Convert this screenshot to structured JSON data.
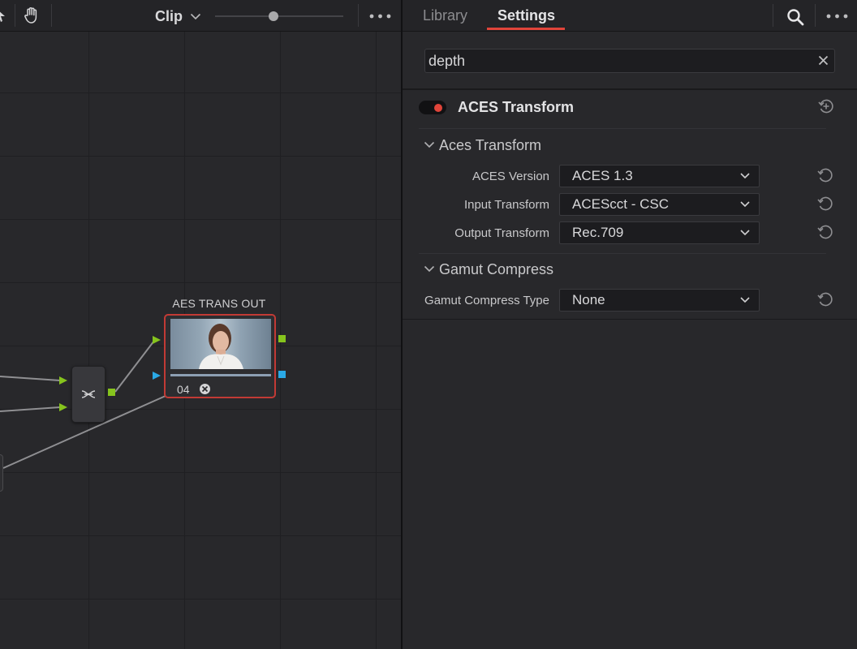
{
  "toolbar": {
    "mode_label": "Clip",
    "zoom_level": 0.45
  },
  "nodes": {
    "output_node": {
      "title": "AES TRANS OUT",
      "number": "04"
    }
  },
  "tabs": {
    "library": "Library",
    "settings": "Settings"
  },
  "search": {
    "value": "depth"
  },
  "effect": {
    "name": "ACES Transform",
    "enabled": true,
    "sections": {
      "aces": {
        "title": "Aces Transform",
        "rows": [
          {
            "label": "ACES Version",
            "value": "ACES 1.3"
          },
          {
            "label": "Input Transform",
            "value": "ACEScct - CSC"
          },
          {
            "label": "Output Transform",
            "value": "Rec.709"
          }
        ]
      },
      "gamut": {
        "title": "Gamut Compress",
        "rows": [
          {
            "label": "Gamut Compress Type",
            "value": "None"
          }
        ]
      }
    }
  },
  "colors": {
    "accent": "#e0443a",
    "node_output_green": "#7fc31c",
    "node_output_blue": "#27a9e6"
  }
}
